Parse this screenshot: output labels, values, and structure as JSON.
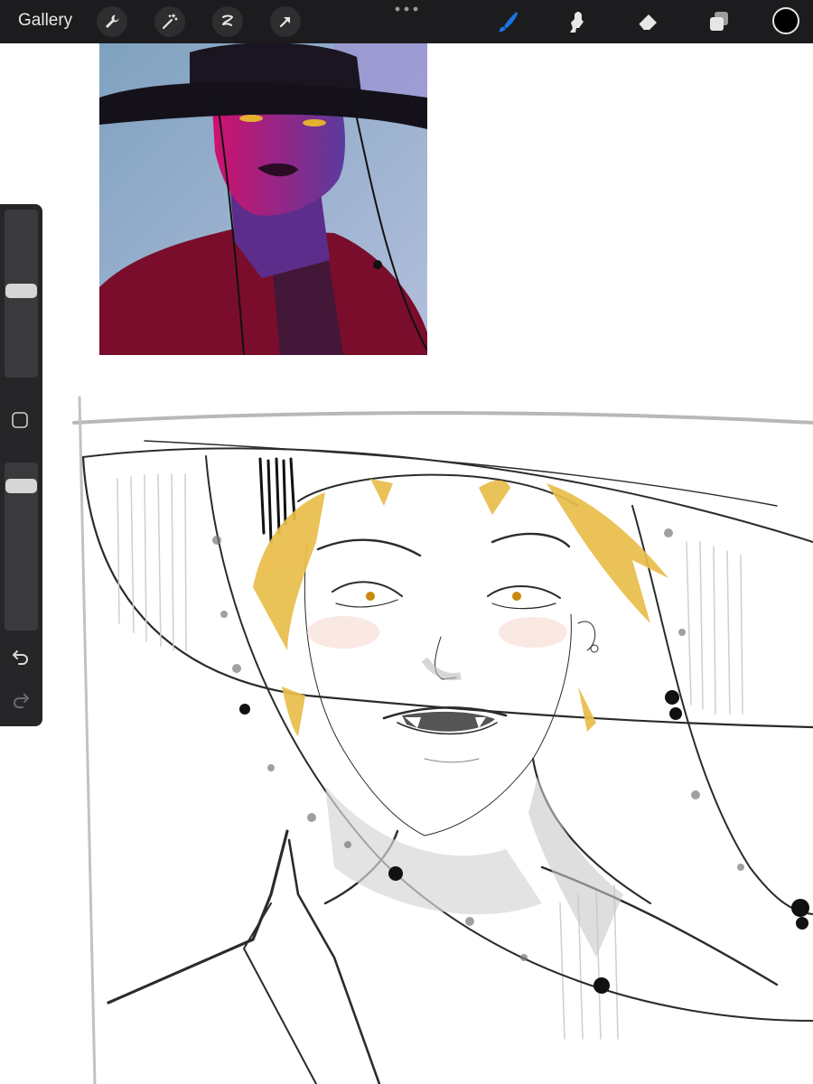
{
  "toolbar": {
    "gallery_label": "Gallery",
    "left_tools": [
      "wrench-icon",
      "magic-wand-icon",
      "selection-icon",
      "transform-arrow-icon"
    ],
    "right_tools": [
      "brush-icon",
      "smudge-icon",
      "eraser-icon",
      "layers-icon"
    ],
    "active_tool": "brush-icon",
    "accent_color": "#1a74e8",
    "current_color": "#000000"
  },
  "sidebar": {
    "brush_size_level": 0.5,
    "opacity_level": 0.85,
    "tools": [
      "modify-button",
      "undo-icon",
      "redo-icon"
    ]
  },
  "canvas": {
    "reference_image": "purple-hat-character-photo",
    "sketch": "pencil-sketch-hat-character",
    "hair_color": "#e8bd4a"
  }
}
